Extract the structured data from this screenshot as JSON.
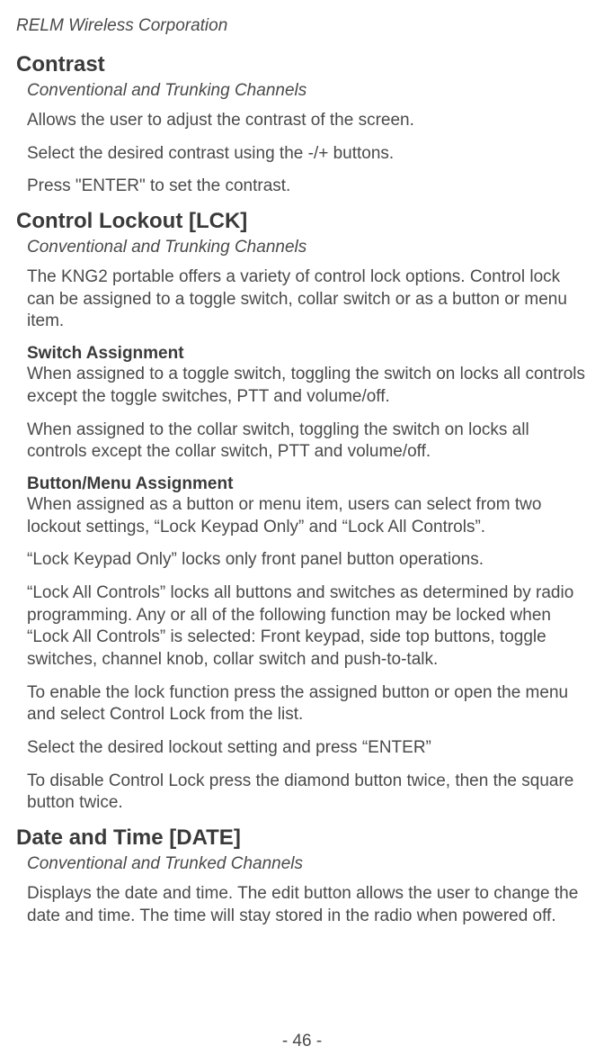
{
  "company": "RELM Wireless Corporation",
  "sections": {
    "contrast": {
      "title": "Contrast",
      "subtitle": "Conventional and Trunking Channels",
      "p1": "Allows the user to adjust the contrast of the screen.",
      "p2": "Select the desired contrast using the -/+ buttons.",
      "p3": "Press \"ENTER\" to set the contrast."
    },
    "control_lockout": {
      "title": "Control Lockout [LCK]",
      "subtitle": "Conventional and Trunking Channels",
      "p1": "The KNG2 portable offers a variety of control lock options. Control lock can be assigned to a toggle switch, collar switch or as a button or menu item.",
      "switch_heading": "Switch Assignment",
      "p2": "When assigned to a toggle switch, toggling the switch on locks all controls except the toggle switches, PTT and volume/off.",
      "p3": "When assigned to the collar switch, toggling the switch on locks all controls except the collar switch, PTT and volume/off.",
      "button_heading": "Button/Menu Assignment",
      "p4": "When assigned as a button or menu item, users can select from two lockout settings, “Lock Keypad Only” and “Lock All Controls”.",
      "p5": "“Lock Keypad Only” locks only front panel button operations.",
      "p6": "“Lock All Controls” locks all buttons and switches as determined by radio programming. Any or all of the following function may be locked when “Lock All Controls” is selected: Front keypad, side top buttons, toggle switches, channel knob, collar switch and push-to-talk.",
      "p7": "To enable the lock function press the assigned button or open the menu and select Control Lock from the list.",
      "p8": "Select the desired lockout setting and press “ENTER”",
      "p9": "To disable Control Lock press the diamond button twice, then the square button twice."
    },
    "date_time": {
      "title": "Date and Time [DATE]",
      "subtitle": "Conventional and Trunked Channels",
      "p1": "Displays the date and time. The edit button allows the user to change the date and time. The time will stay stored in the radio when powered off."
    }
  },
  "page_number": "- 46 -"
}
